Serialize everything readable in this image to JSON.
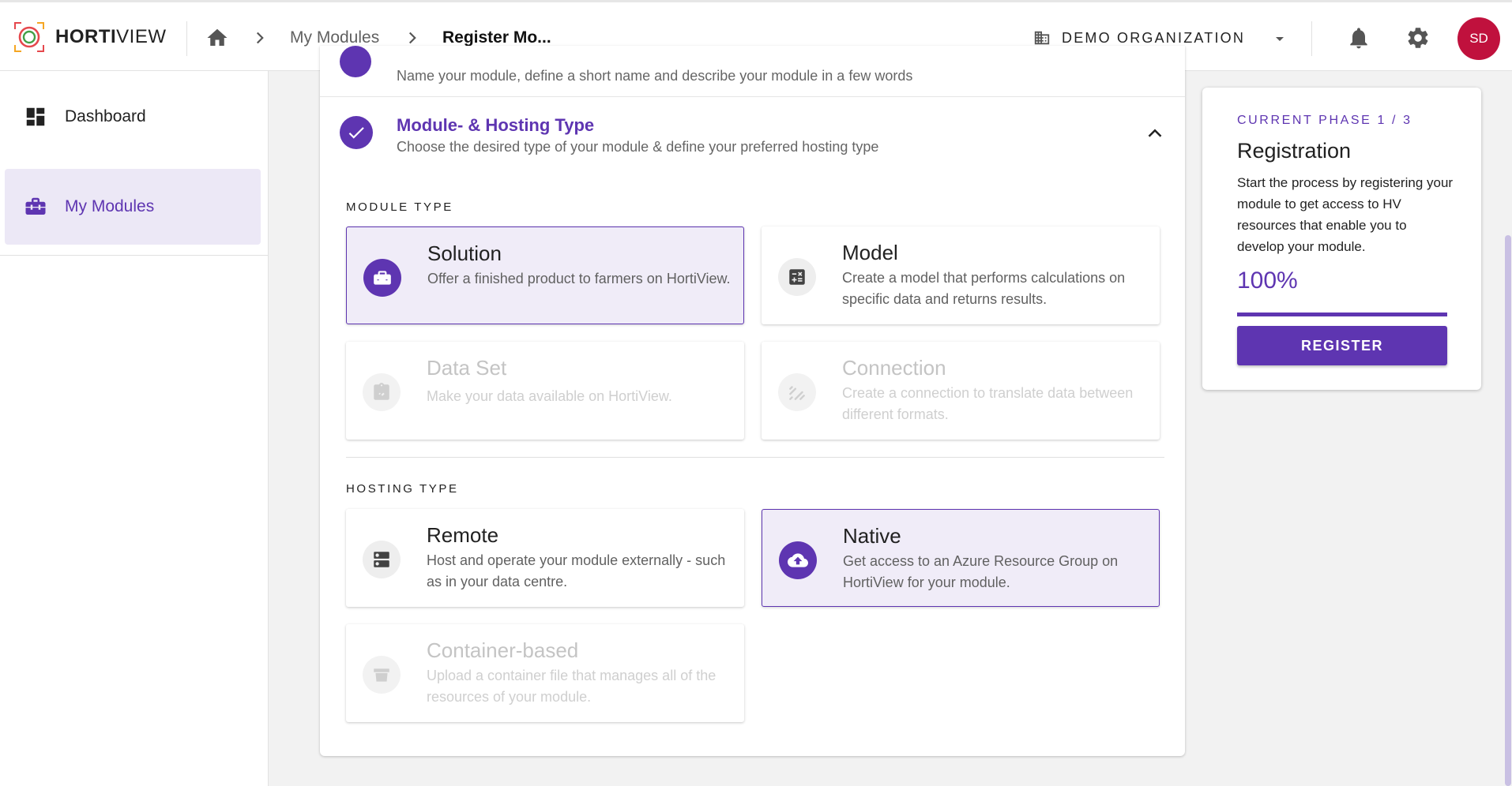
{
  "app": {
    "logo_bold": "HORTI",
    "logo_light": "VIEW"
  },
  "breadcrumb": {
    "items": [
      "My Modules",
      "Register Mo..."
    ]
  },
  "header": {
    "organization": "DEMO ORGANIZATION",
    "avatar_initials": "SD"
  },
  "sidebar": {
    "items": [
      {
        "label": "Dashboard",
        "icon": "dashboard-icon",
        "active": false
      },
      {
        "label": "My Modules",
        "icon": "briefcase-icon",
        "active": true
      }
    ]
  },
  "steps": {
    "step1": {
      "description": "Name your module, define a short name and describe your module in a few words"
    },
    "step2": {
      "title": "Module- & Hosting Type",
      "description": "Choose the desired type of your module & define your preferred hosting type"
    }
  },
  "module_type": {
    "label": "MODULE TYPE",
    "options": [
      {
        "title": "Solution",
        "description": "Offer a finished product to farmers on HortiView.",
        "icon": "toolbox-icon",
        "selected": true,
        "disabled": false
      },
      {
        "title": "Model",
        "description": "Create a model that performs calculations on specific data and returns results.",
        "icon": "calculator-icon",
        "selected": false,
        "disabled": false
      },
      {
        "title": "Data Set",
        "description": "Make your data available on HortiView.",
        "icon": "code-clipboard-icon",
        "selected": false,
        "disabled": true
      },
      {
        "title": "Connection",
        "description": "Create a connection to translate data between different formats.",
        "icon": "signal-icon",
        "selected": false,
        "disabled": true
      }
    ]
  },
  "hosting_type": {
    "label": "HOSTING TYPE",
    "options": [
      {
        "title": "Remote",
        "description": "Host and operate your module externally - such as in your data centre.",
        "icon": "server-icon",
        "selected": false,
        "disabled": false
      },
      {
        "title": "Native",
        "description": "Get access to an Azure Resource Group on HortiView for your module.",
        "icon": "cloud-upload-icon",
        "selected": true,
        "disabled": false
      },
      {
        "title": "Container-based",
        "description": "Upload a container file that manages all of the resources of your module.",
        "icon": "container-icon",
        "selected": false,
        "disabled": true
      }
    ]
  },
  "phase": {
    "label": "CURRENT PHASE 1 / 3",
    "title": "Registration",
    "description": "Start the process by registering your module to get access to HV resources that enable you to develop your module.",
    "percent_text": "100%",
    "progress": 1.0,
    "button_label": "REGISTER"
  },
  "colors": {
    "primary": "#5e35b1",
    "selected_bg": "#f0ecf8",
    "avatar": "#c0113d"
  }
}
